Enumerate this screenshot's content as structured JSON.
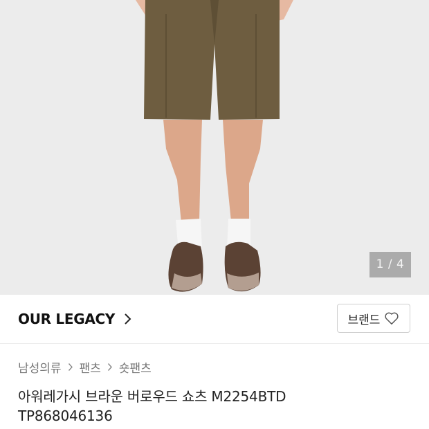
{
  "gallery": {
    "image_alt": "brown shorts worn by model with white socks and brown shoes",
    "counter": "1 / 4",
    "colors": {
      "background": "#ececec",
      "shorts": "#6b5a3e",
      "socks": "#f5f5f5",
      "shoes": "#5a4235"
    }
  },
  "brand": {
    "name": "OUR LEGACY",
    "button_label": "브랜드",
    "chevron_icon": "chevron-right-icon",
    "heart_icon": "heart-outline-icon"
  },
  "breadcrumb": {
    "items": [
      "남성의류",
      "팬츠",
      "숏팬츠"
    ]
  },
  "product": {
    "title": "아워레가시 브라운 버로우드 쇼츠 M2254BTD",
    "code": "TP868046136"
  }
}
